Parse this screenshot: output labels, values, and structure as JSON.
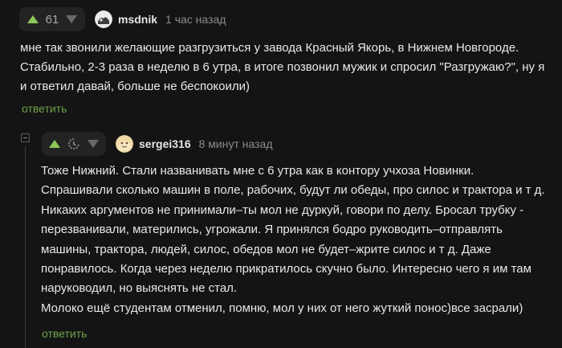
{
  "comment1": {
    "score": "61",
    "username": "msdnik",
    "time": "1 час назад",
    "text": "мне так звонили желающие разгрузиться у завода Красный Якорь, в Нижнем Новгороде. Стабильно, 2-3 раза в неделю в 6 утра, в итоге позвонил мужик и спросил \"Разгружаю?\", ну я и ответил давай, больше не беспокоили)",
    "reply_label": "ответить"
  },
  "comment2": {
    "username": "sergei316",
    "time": "8 минут назад",
    "lines": [
      "Тоже Нижний. Стали названивать мне с 6 утра как в контору учхоза Новинки.",
      "Спрашивали сколько машин в поле, рабочих, будут ли обеды, про силос и трактора и т д.",
      "Никаких аргументов не принимали–ты мол не дуркуй, говори по делу. Бросал трубку -",
      "перезванивали, матерились, угрожали. Я принялся бодро руководить–отправлять",
      "машины, трактора, людей, силос, обедов мол не будет–жрите силос и т д. Даже",
      "понравилось. Когда через неделю прикратилось скучно было. Интересно чего я им там",
      "наруководил, но выяснять не стал.",
      "Молоко ещё студентам отменил, помню, мол у них от него жуткий понос)все засрали)"
    ],
    "reply_label": "ответить"
  },
  "colors": {
    "background": "#141414",
    "accent_green": "#6ea34a",
    "text": "#e8e8e8",
    "muted": "#8c8c8c"
  },
  "icons": [
    "arrow-up-icon",
    "arrow-down-icon",
    "avatar",
    "pending-rating-icon",
    "collapse-icon"
  ]
}
